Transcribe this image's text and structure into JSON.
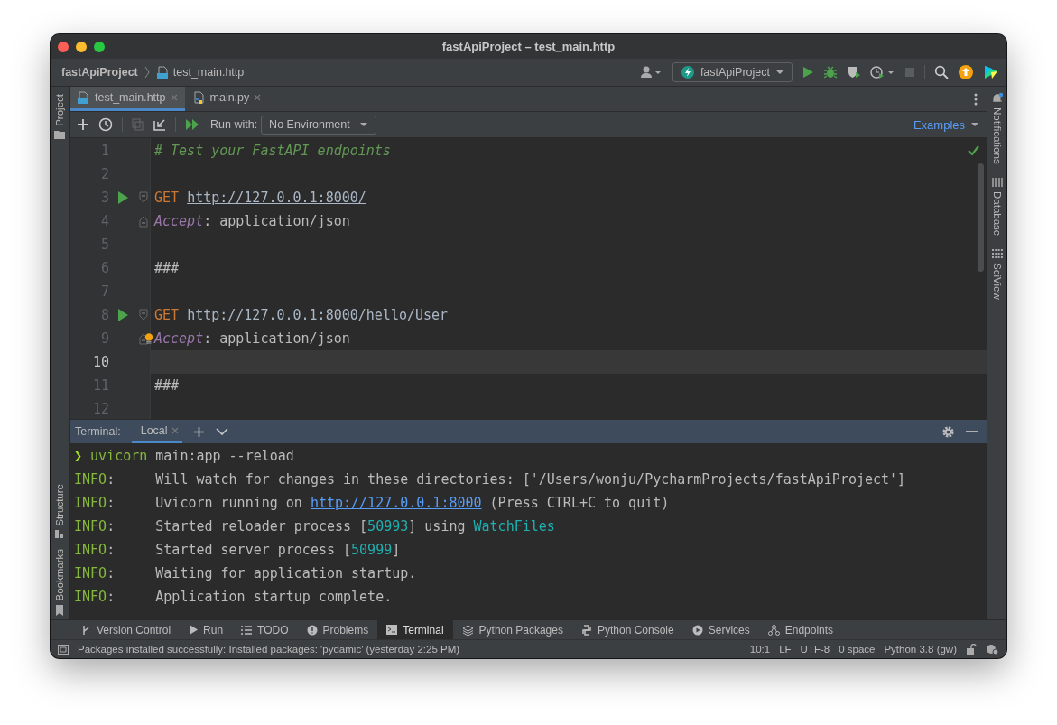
{
  "window": {
    "title": "fastApiProject – test_main.http"
  },
  "navbar": {
    "breadcrumbs": [
      {
        "label": "fastApiProject",
        "kind": "project"
      },
      {
        "label": "test_main.http",
        "kind": "http"
      }
    ],
    "run_config": "fastApiProject"
  },
  "left_strip": {
    "top": [
      {
        "label": "Project",
        "kind": "folder"
      }
    ],
    "bottom": [
      {
        "label": "Structure",
        "kind": "structure"
      },
      {
        "label": "Bookmarks",
        "kind": "bookmark"
      }
    ]
  },
  "right_strip": [
    {
      "label": "Notifications",
      "kind": "bell"
    },
    {
      "label": "Database",
      "kind": "database"
    },
    {
      "label": "SciView",
      "kind": "grid"
    }
  ],
  "editor_tabs": [
    {
      "label": "test_main.http",
      "kind": "http",
      "selected": true
    },
    {
      "label": "main.py",
      "kind": "python",
      "selected": false
    }
  ],
  "editor_toolbar": {
    "run_with_label": "Run with:",
    "environment": "No Environment",
    "examples": "Examples"
  },
  "code_lines": [
    {
      "number": "1",
      "run": false,
      "fold_start": false,
      "fold_end": false,
      "bulb": false,
      "current": false,
      "tokens": [
        {
          "text": "# Test your FastAPI endpoints",
          "kind": "comment"
        }
      ]
    },
    {
      "number": "2",
      "run": false,
      "fold_start": false,
      "fold_end": false,
      "bulb": false,
      "current": false
    },
    {
      "number": "3",
      "run": true,
      "fold_start": true,
      "fold_end": false,
      "bulb": false,
      "current": false,
      "tokens": [
        {
          "text": "GET ",
          "kind": "method"
        },
        {
          "text": "http://127.0.0.1:8000/",
          "kind": "url"
        }
      ]
    },
    {
      "number": "4",
      "run": false,
      "fold_start": false,
      "fold_end": true,
      "bulb": false,
      "current": false,
      "tokens": [
        {
          "text": "Accept",
          "kind": "header"
        },
        {
          "text": ": application/json",
          "kind": "plain"
        }
      ]
    },
    {
      "number": "5",
      "run": false,
      "fold_start": false,
      "fold_end": false,
      "bulb": false,
      "current": false
    },
    {
      "number": "6",
      "run": false,
      "fold_start": false,
      "fold_end": false,
      "bulb": false,
      "current": false,
      "tokens": [
        {
          "text": "###",
          "kind": "plain"
        }
      ]
    },
    {
      "number": "7",
      "run": false,
      "fold_start": false,
      "fold_end": false,
      "bulb": false,
      "current": false
    },
    {
      "number": "8",
      "run": true,
      "fold_start": true,
      "fold_end": false,
      "bulb": false,
      "current": false,
      "tokens": [
        {
          "text": "GET ",
          "kind": "method"
        },
        {
          "text": "http://127.0.0.1:8000/hello/User",
          "kind": "url"
        }
      ]
    },
    {
      "number": "9",
      "run": false,
      "fold_start": false,
      "fold_end": true,
      "bulb": true,
      "current": false,
      "tokens": [
        {
          "text": "Accept",
          "kind": "header"
        },
        {
          "text": ": application/json",
          "kind": "plain"
        }
      ]
    },
    {
      "number": "10",
      "run": false,
      "fold_start": false,
      "fold_end": false,
      "bulb": false,
      "current": true
    },
    {
      "number": "11",
      "run": false,
      "fold_start": false,
      "fold_end": false,
      "bulb": false,
      "current": false,
      "tokens": [
        {
          "text": "###",
          "kind": "plain"
        }
      ]
    },
    {
      "number": "12",
      "run": false,
      "fold_start": false,
      "fold_end": false,
      "bulb": false,
      "current": false
    }
  ],
  "terminal": {
    "label": "Terminal:",
    "tabs": [
      {
        "label": "Local",
        "selected": true
      }
    ],
    "lines": [
      [
        {
          "text": "❯ ",
          "kind": "prompt"
        },
        {
          "text": "uvicorn",
          "kind": "cmd"
        },
        {
          "text": " main:app --reload",
          "kind": "plain"
        }
      ],
      [
        {
          "text": "INFO",
          "kind": "info"
        },
        {
          "text": ":     Will watch for changes in these directories: ['/Users/wonju/PycharmProjects/fastApiProject']",
          "kind": "plain"
        }
      ],
      [
        {
          "text": "INFO",
          "kind": "info"
        },
        {
          "text": ":     Uvicorn running on ",
          "kind": "plain"
        },
        {
          "text": "http://127.0.0.1:8000",
          "kind": "link"
        },
        {
          "text": " (Press CTRL+C to quit)",
          "kind": "plain"
        }
      ],
      [
        {
          "text": "INFO",
          "kind": "info"
        },
        {
          "text": ":     Started reloader process [",
          "kind": "plain"
        },
        {
          "text": "50993",
          "kind": "accent"
        },
        {
          "text": "] using ",
          "kind": "plain"
        },
        {
          "text": "WatchFiles",
          "kind": "accent"
        }
      ],
      [
        {
          "text": "INFO",
          "kind": "info"
        },
        {
          "text": ":     Started server process [",
          "kind": "plain"
        },
        {
          "text": "50999",
          "kind": "accent"
        },
        {
          "text": "]",
          "kind": "plain"
        }
      ],
      [
        {
          "text": "INFO",
          "kind": "info"
        },
        {
          "text": ":     Waiting for application startup.",
          "kind": "plain"
        }
      ],
      [
        {
          "text": "INFO",
          "kind": "info"
        },
        {
          "text": ":     Application startup complete.",
          "kind": "plain"
        }
      ]
    ]
  },
  "tool_tabs": [
    {
      "label": "Version Control",
      "kind": "branch",
      "selected": false
    },
    {
      "label": "Run",
      "kind": "run",
      "selected": false
    },
    {
      "label": "TODO",
      "kind": "list",
      "selected": false
    },
    {
      "label": "Problems",
      "kind": "alert",
      "selected": false
    },
    {
      "label": "Terminal",
      "kind": "terminal",
      "selected": true
    },
    {
      "label": "Python Packages",
      "kind": "layers",
      "selected": false
    },
    {
      "label": "Python Console",
      "kind": "python",
      "selected": false
    },
    {
      "label": "Services",
      "kind": "services",
      "selected": false
    },
    {
      "label": "Endpoints",
      "kind": "endpoints",
      "selected": false
    }
  ],
  "status_bar": {
    "message": "Packages installed successfully: Installed packages: 'pydamic' (yesterday 2:25 PM)",
    "items": [
      "10:1",
      "LF",
      "UTF-8",
      "0 space",
      "Python 3.8 (gw)"
    ]
  }
}
